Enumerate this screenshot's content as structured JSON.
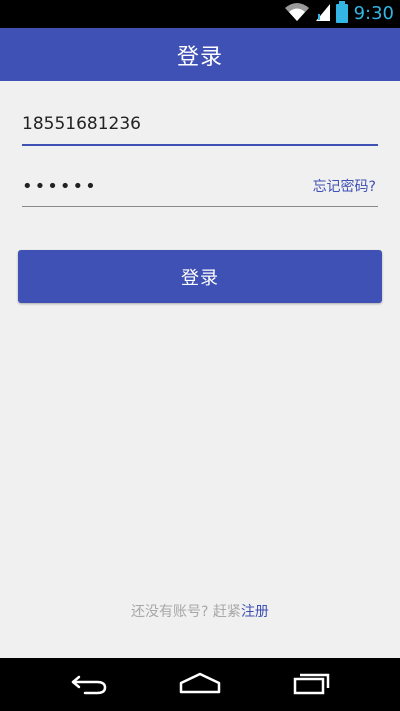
{
  "status_bar": {
    "time": "9:30",
    "icons": [
      "wifi-icon",
      "signal-icon",
      "battery-icon"
    ],
    "accent_color": "#33b5e5"
  },
  "app_bar": {
    "title": "登录",
    "color": "#3f51b5"
  },
  "form": {
    "phone": {
      "value": "18551681236"
    },
    "password": {
      "value": "••••••"
    },
    "forgot_password_label": "忘记密码?",
    "login_button_label": "登录"
  },
  "footer": {
    "prompt": "还没有账号? 赶紧",
    "register_label": "注册"
  },
  "nav_bar": {
    "icons": [
      "back-icon",
      "home-icon",
      "recents-icon"
    ]
  }
}
